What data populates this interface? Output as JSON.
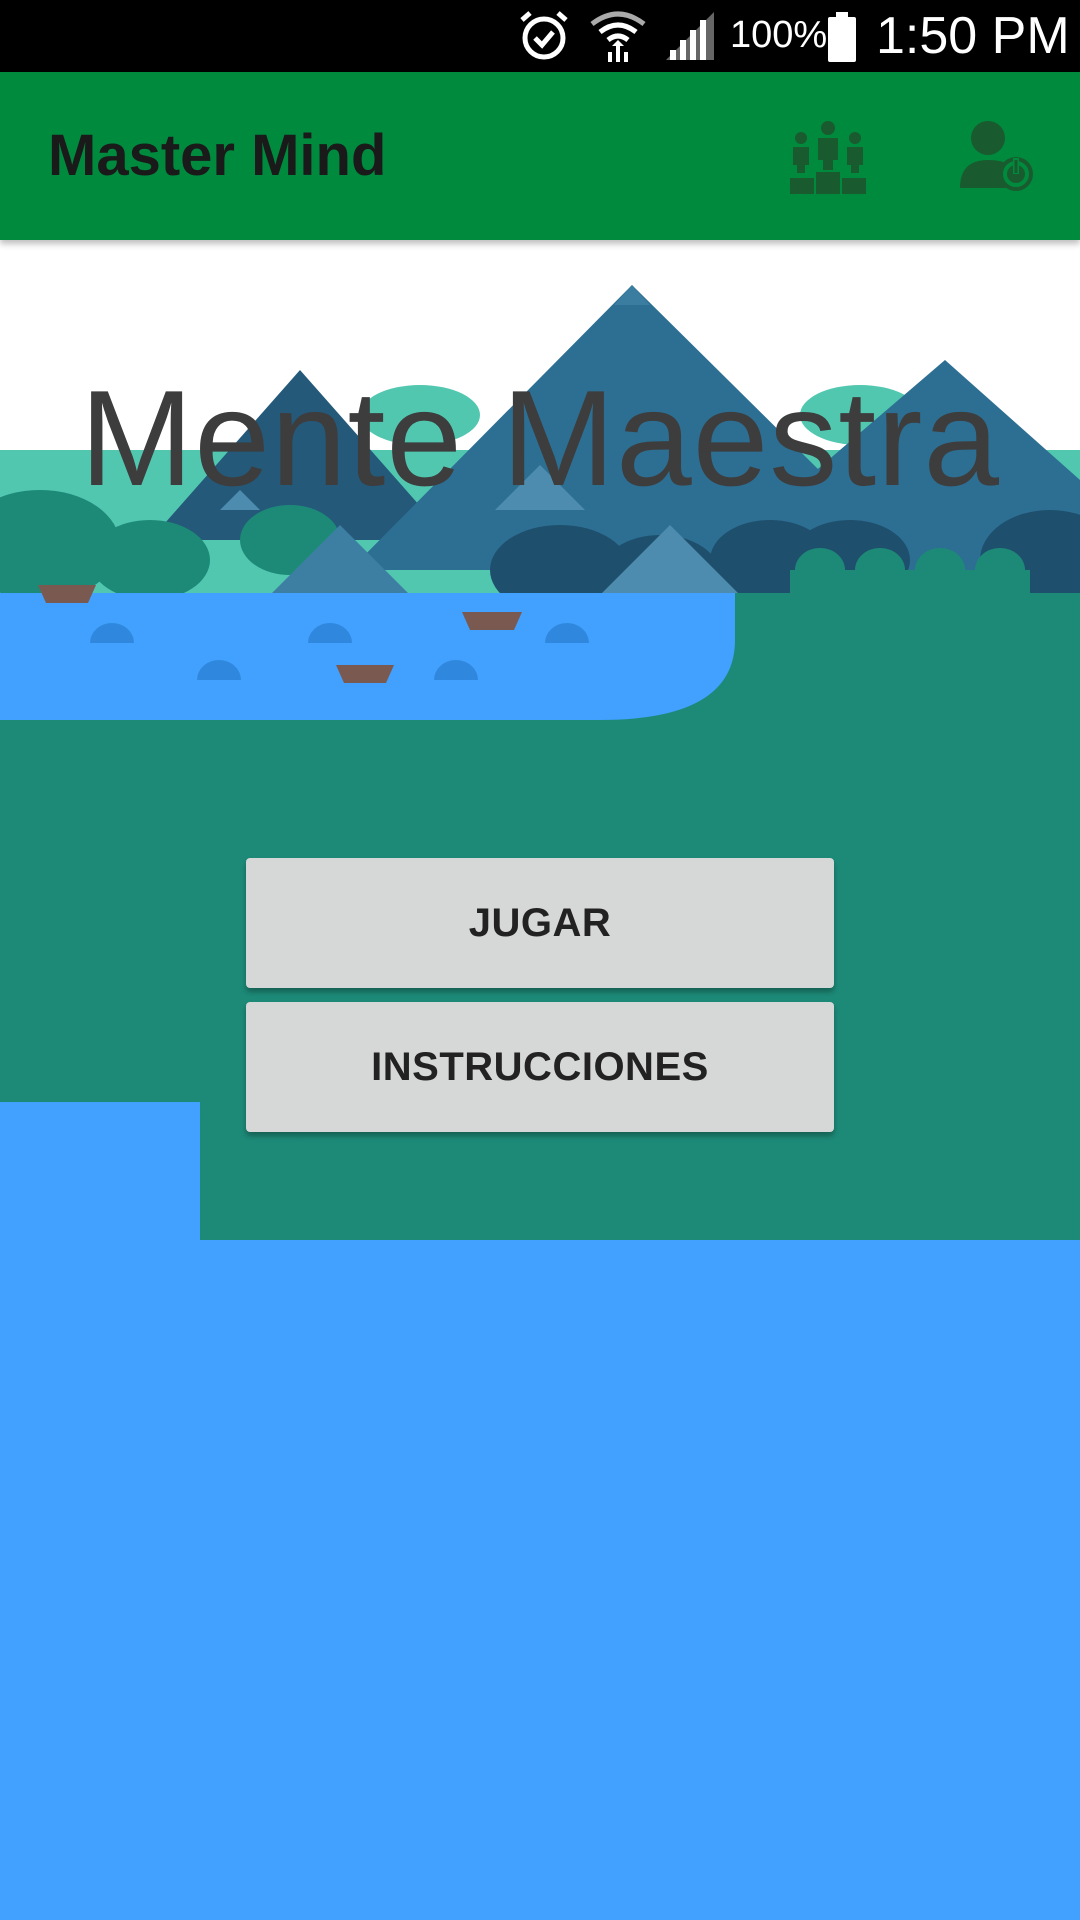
{
  "status_bar": {
    "icons": [
      "alarm-icon",
      "wifi-icon",
      "signal-icon",
      "battery-icon"
    ],
    "battery_percent": "100%",
    "time": "1:50 PM"
  },
  "app_bar": {
    "title": "Master Mind",
    "actions": [
      {
        "icon": "leaderboard-podium-icon"
      },
      {
        "icon": "user-logout-icon"
      }
    ],
    "color": "#008a3e"
  },
  "main": {
    "hero_title": "Mente Maestra",
    "buttons": [
      {
        "label": "JUGAR"
      },
      {
        "label": "INSTRUCCIONES"
      }
    ]
  },
  "colors": {
    "water": "#42a0fe",
    "land": "#1d8a78",
    "mountain": "#2d6e93",
    "hills": "#52c7b0",
    "button_bg": "#d6d7d7"
  }
}
